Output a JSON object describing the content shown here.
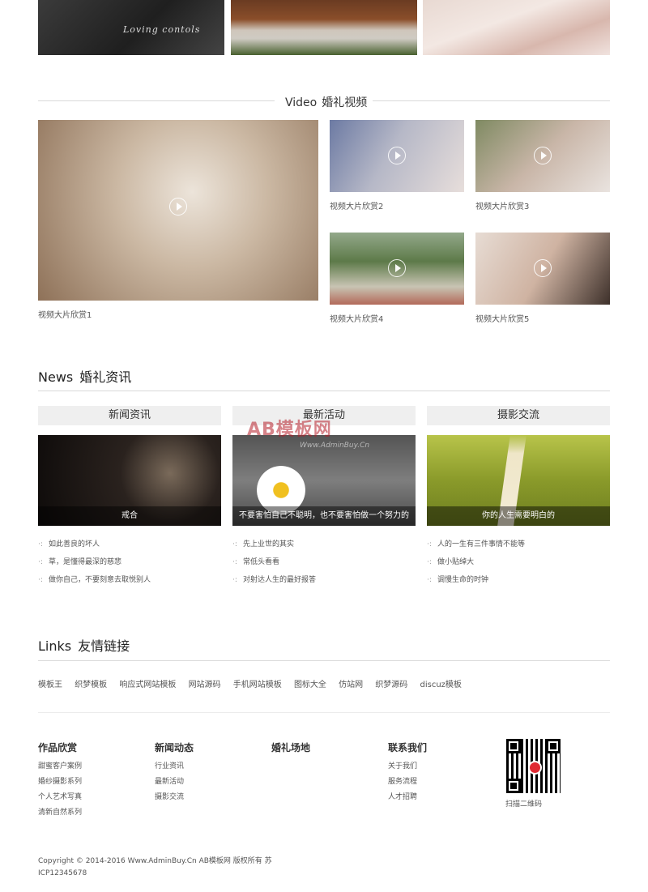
{
  "top_gallery": {
    "script_text": "Loving contols"
  },
  "video": {
    "title_en": "Video",
    "title_cn": "婚礼视频",
    "items": [
      {
        "caption": "视频大片欣赏1"
      },
      {
        "caption": "视频大片欣赏2"
      },
      {
        "caption": "视频大片欣赏3"
      },
      {
        "caption": "视频大片欣赏4"
      },
      {
        "caption": "视频大片欣赏5"
      }
    ]
  },
  "news": {
    "title_en": "News",
    "title_cn": "婚礼资讯",
    "columns": [
      {
        "tab": "新闻资讯",
        "image_caption": "戒合",
        "items": [
          "如此善良的坏人",
          "草，是懂得最深的慈悲",
          "做你自己，不要刻意去取悦别人"
        ]
      },
      {
        "tab": "最新活动",
        "image_caption": "不要害怕自己不聪明，也不要害怕做一个努力的",
        "items": [
          "先上业世的其实",
          "常低头看看",
          "对射达人生的最好报答"
        ]
      },
      {
        "tab": "摄影交流",
        "image_caption": "你的人生需要明白的",
        "items": [
          "人的一生有三件事情不能等",
          "做小贴绰大",
          "调慢生命的时钟"
        ]
      }
    ],
    "watermark": "AB模板网",
    "watermark_sub": "Www.AdminBuy.Cn"
  },
  "links": {
    "title_en": "Links",
    "title_cn": "友情链接",
    "items": [
      "模板王",
      "织梦模板",
      "响应式网站模板",
      "网站源码",
      "手机网站模板",
      "图标大全",
      "仿站网",
      "织梦源码",
      "discuz模板"
    ]
  },
  "footer": {
    "columns": [
      {
        "heading": "作品欣赏",
        "items": [
          "甜蜜客户案例",
          "婚纱摄影系列",
          "个人艺术写真",
          "清新自然系列"
        ]
      },
      {
        "heading": "新闻动态",
        "items": [
          "行业资讯",
          "最新活动",
          "摄影交流"
        ]
      },
      {
        "heading": "婚礼场地",
        "items": []
      },
      {
        "heading": "联系我们",
        "items": [
          "关于我们",
          "服务流程",
          "人才招聘"
        ]
      }
    ],
    "qr_caption": "扫描二维码",
    "copyright": "Copyright © 2014-2016 Www.AdminBuy.Cn AB模板网 版权所有 苏ICP12345678"
  }
}
